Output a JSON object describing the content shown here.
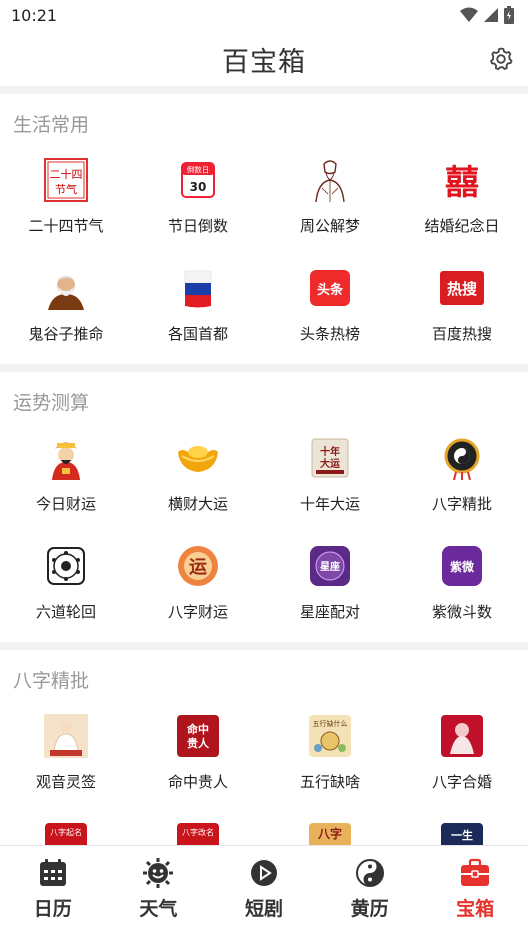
{
  "status": {
    "time": "10:21"
  },
  "header": {
    "title": "百宝箱",
    "settings_icon": "gear-icon"
  },
  "sections": [
    {
      "title": "生活常用",
      "items": [
        {
          "label": "二十四节气",
          "icon": "solar-terms-icon"
        },
        {
          "label": "节日倒数",
          "icon": "countdown-calendar-icon",
          "badge": "倒数日",
          "num": "30"
        },
        {
          "label": "周公解梦",
          "icon": "zhougong-portrait-icon"
        },
        {
          "label": "结婚纪念日",
          "icon": "double-happiness-icon"
        },
        {
          "label": "鬼谷子推命",
          "icon": "guiguzi-portrait-icon"
        },
        {
          "label": "各国首都",
          "icon": "flag-icon"
        },
        {
          "label": "头条热榜",
          "icon": "toutiao-icon",
          "badge": "头条"
        },
        {
          "label": "百度热搜",
          "icon": "hot-search-icon",
          "badge": "热搜"
        }
      ]
    },
    {
      "title": "运势测算",
      "items": [
        {
          "label": "今日财运",
          "icon": "god-of-wealth-icon"
        },
        {
          "label": "横财大运",
          "icon": "gold-ingot-icon"
        },
        {
          "label": "十年大运",
          "icon": "ten-year-fortune-icon",
          "badge": "十年大运"
        },
        {
          "label": "八字精批",
          "icon": "bagua-compass-icon"
        },
        {
          "label": "六道轮回",
          "icon": "six-paths-icon"
        },
        {
          "label": "八字财运",
          "icon": "bazi-wealth-icon",
          "badge": "运"
        },
        {
          "label": "星座配对",
          "icon": "zodiac-match-icon",
          "badge": "星座"
        },
        {
          "label": "紫微斗数",
          "icon": "ziwei-icon",
          "badge": "紫微"
        }
      ]
    },
    {
      "title": "八字精批",
      "items": [
        {
          "label": "观音灵签",
          "icon": "guanyin-icon"
        },
        {
          "label": "命中贵人",
          "icon": "noble-person-icon",
          "badge": "命中贵人"
        },
        {
          "label": "五行缺啥",
          "icon": "five-elements-icon",
          "badge": "五行缺什么"
        },
        {
          "label": "八字合婚",
          "icon": "marriage-match-icon"
        },
        {
          "label": "",
          "icon": "bazi-naming-icon",
          "badge": "八字起名"
        },
        {
          "label": "",
          "icon": "bazi-rename-icon",
          "badge": "八字改名"
        },
        {
          "label": "",
          "icon": "bazi-analysis-icon",
          "badge": "八字"
        },
        {
          "label": "",
          "icon": "lifetime-fortune-icon",
          "badge": "一生"
        }
      ]
    }
  ],
  "nav": [
    {
      "label": "日历",
      "icon": "calendar-icon"
    },
    {
      "label": "天气",
      "icon": "weather-icon"
    },
    {
      "label": "短剧",
      "icon": "play-icon"
    },
    {
      "label": "黄历",
      "icon": "yin-yang-icon"
    },
    {
      "label": "宝箱",
      "icon": "toolbox-icon",
      "active": true
    }
  ],
  "colors": {
    "accent": "#e5322d",
    "section_title": "#999999",
    "text": "#222222"
  }
}
